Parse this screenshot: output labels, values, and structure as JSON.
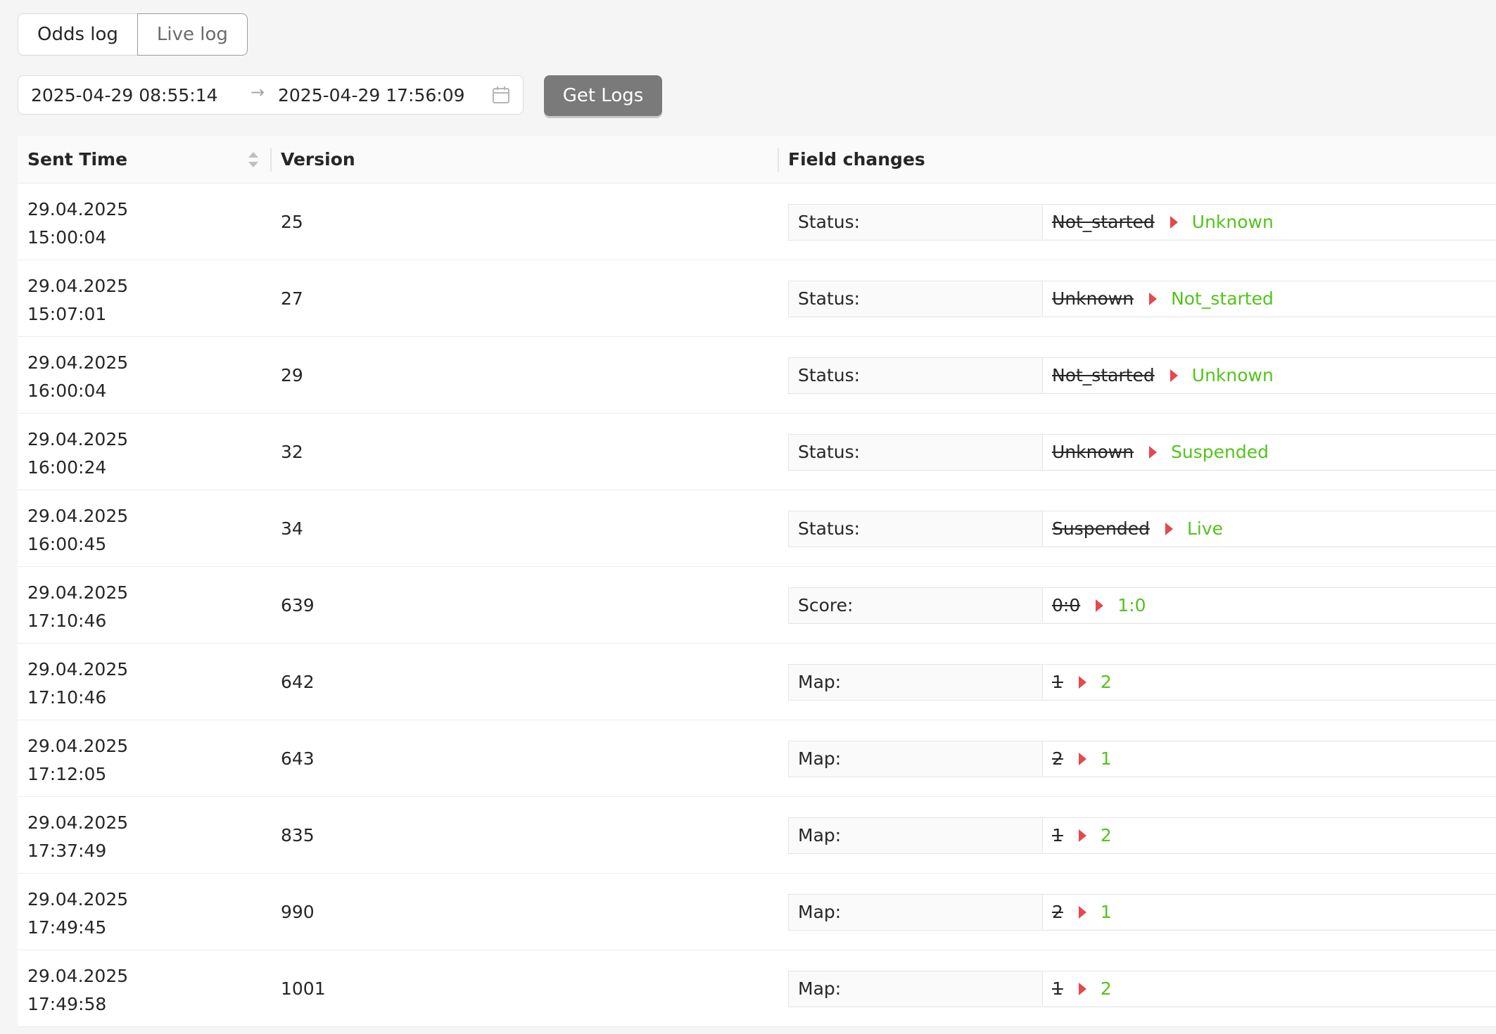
{
  "tabs": [
    {
      "label": "Odds log"
    },
    {
      "label": "Live log"
    }
  ],
  "date_range": {
    "start": "2025-04-29 08:55:14",
    "separator": "→",
    "end": "2025-04-29 17:56:09"
  },
  "get_logs_label": "Get Logs",
  "columns": {
    "sent_time": "Sent Time",
    "version": "Version",
    "field_changes": "Field changes"
  },
  "colors": {
    "new_value": "#52c41a",
    "arrow": "#e5484d",
    "button": "#7a7a7a"
  },
  "rows": [
    {
      "date": "29.04.2025",
      "time": "15:00:04",
      "version": "25",
      "field": "Status:",
      "old": "Not_started",
      "new": "Unknown"
    },
    {
      "date": "29.04.2025",
      "time": "15:07:01",
      "version": "27",
      "field": "Status:",
      "old": "Unknown",
      "new": "Not_started"
    },
    {
      "date": "29.04.2025",
      "time": "16:00:04",
      "version": "29",
      "field": "Status:",
      "old": "Not_started",
      "new": "Unknown"
    },
    {
      "date": "29.04.2025",
      "time": "16:00:24",
      "version": "32",
      "field": "Status:",
      "old": "Unknown",
      "new": "Suspended"
    },
    {
      "date": "29.04.2025",
      "time": "16:00:45",
      "version": "34",
      "field": "Status:",
      "old": "Suspended",
      "new": "Live"
    },
    {
      "date": "29.04.2025",
      "time": "17:10:46",
      "version": "639",
      "field": "Score:",
      "old": "0:0",
      "new": "1:0"
    },
    {
      "date": "29.04.2025",
      "time": "17:10:46",
      "version": "642",
      "field": "Map:",
      "old": "1",
      "new": "2"
    },
    {
      "date": "29.04.2025",
      "time": "17:12:05",
      "version": "643",
      "field": "Map:",
      "old": "2",
      "new": "1"
    },
    {
      "date": "29.04.2025",
      "time": "17:37:49",
      "version": "835",
      "field": "Map:",
      "old": "1",
      "new": "2"
    },
    {
      "date": "29.04.2025",
      "time": "17:49:45",
      "version": "990",
      "field": "Map:",
      "old": "2",
      "new": "1"
    },
    {
      "date": "29.04.2025",
      "time": "17:49:58",
      "version": "1001",
      "field": "Map:",
      "old": "1",
      "new": "2"
    }
  ]
}
